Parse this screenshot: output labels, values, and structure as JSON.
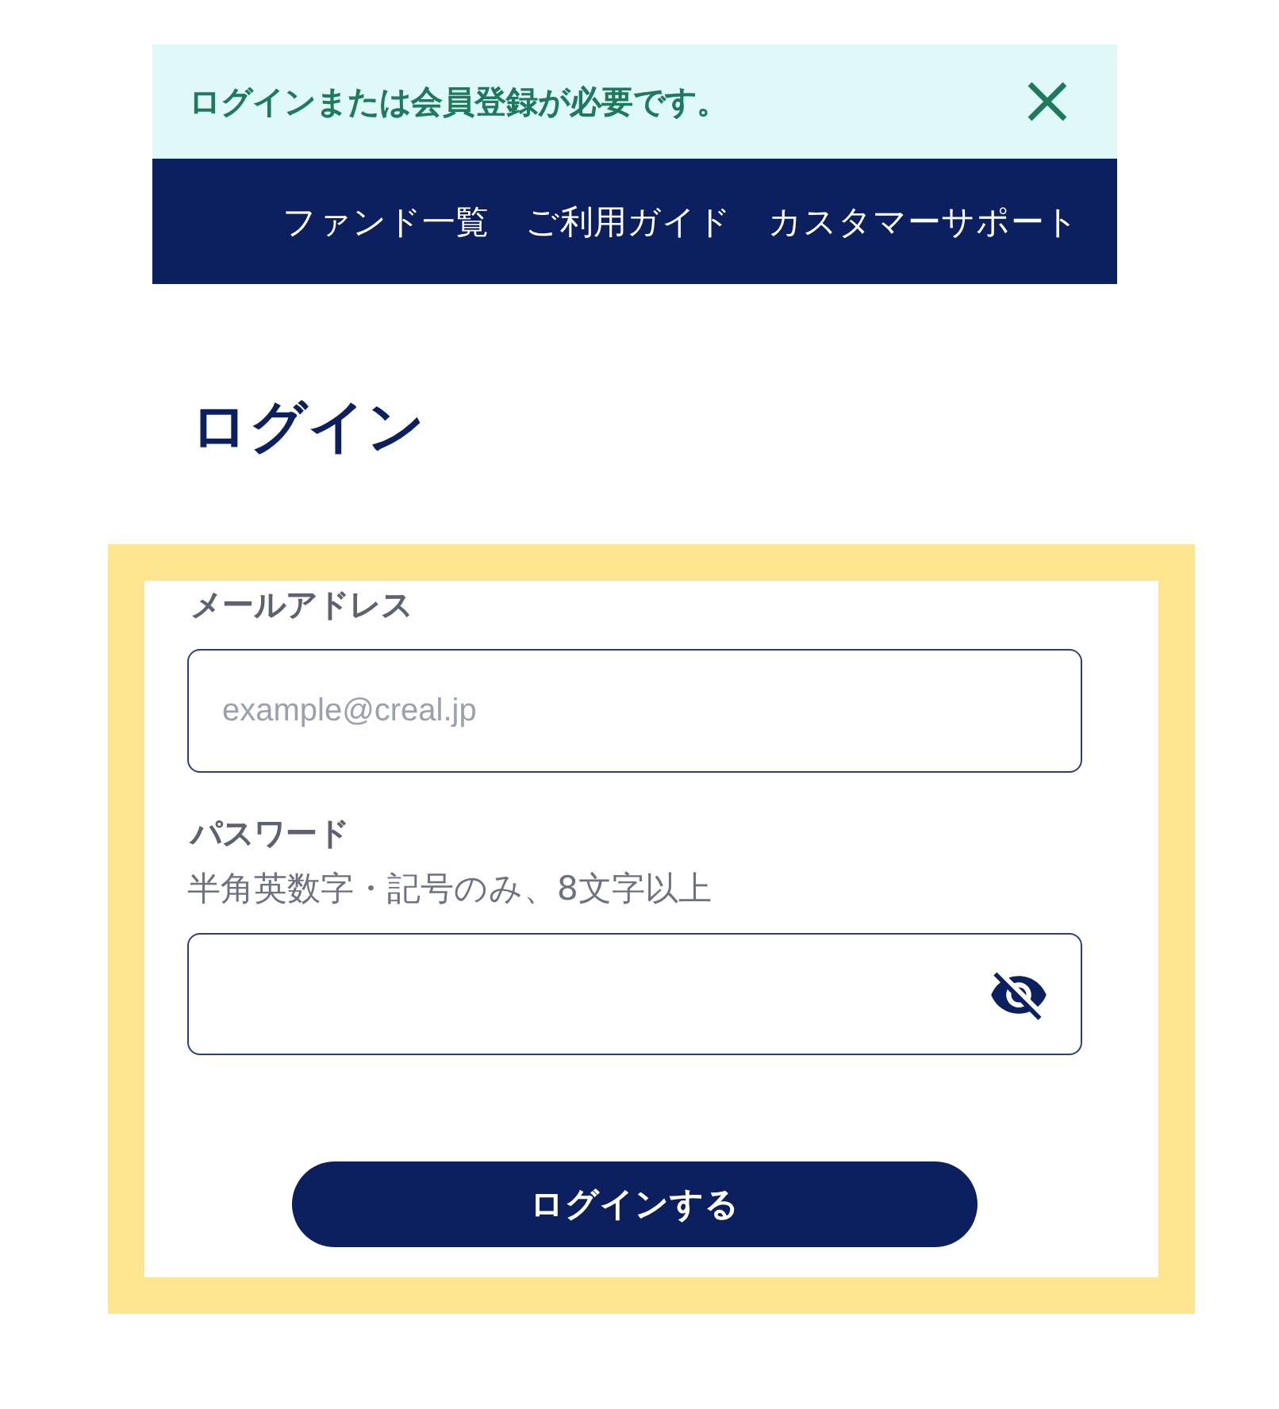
{
  "notice": {
    "message": "ログインまたは会員登録が必要です。"
  },
  "header": {
    "nav": [
      "ファンド一覧",
      "ご利用ガイド",
      "カスタマーサポート"
    ]
  },
  "page_title": "ログイン",
  "form": {
    "email": {
      "label": "メールアドレス",
      "placeholder": "example@creal.jp"
    },
    "password": {
      "label": "パスワード",
      "hint": "半角英数字・記号のみ、8文字以上",
      "visible": false
    },
    "submit": "ログインする"
  }
}
